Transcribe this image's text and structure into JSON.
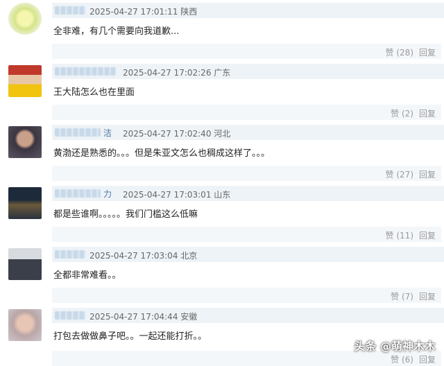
{
  "comments": [
    {
      "username_tail": "",
      "timestamp": "2025-04-27 17:01:11",
      "location": "陕西",
      "text": "全非难，有几个需要向我道歉...",
      "likes": "赞 (28)",
      "reply": "回复"
    },
    {
      "username_tail": "",
      "timestamp": "2025-04-27 17:02:26",
      "location": "广东",
      "text": "王大陆怎么也在里面",
      "likes": "赞 (2)",
      "reply": "回复"
    },
    {
      "username_tail": "洁",
      "timestamp": "2025-04-27 17:02:40",
      "location": "河北",
      "text": "黄渤还是熟悉的。。。但是朱亚文怎么也稠成这样了。。。",
      "likes": "赞 (27)",
      "reply": "回复"
    },
    {
      "username_tail": "力",
      "timestamp": "2025-04-27 17:03:01",
      "location": "山东",
      "text": "都是些谁啊。。。。。我们门槛这么低嘛",
      "likes": "赞 (11)",
      "reply": "回复"
    },
    {
      "username_tail": "",
      "timestamp": "2025-04-27 17:03:04",
      "location": "北京",
      "text": "全都非常难看。。",
      "likes": "赞 (7)",
      "reply": "回复"
    },
    {
      "username_tail": "",
      "timestamp": "2025-04-27 17:04:44",
      "location": "安徽",
      "text": "打包去做做鼻子吧。。一起还能打折。。",
      "likes": "赞 (6)",
      "reply": "回复"
    }
  ],
  "watermark": "头条 @萌神木木"
}
